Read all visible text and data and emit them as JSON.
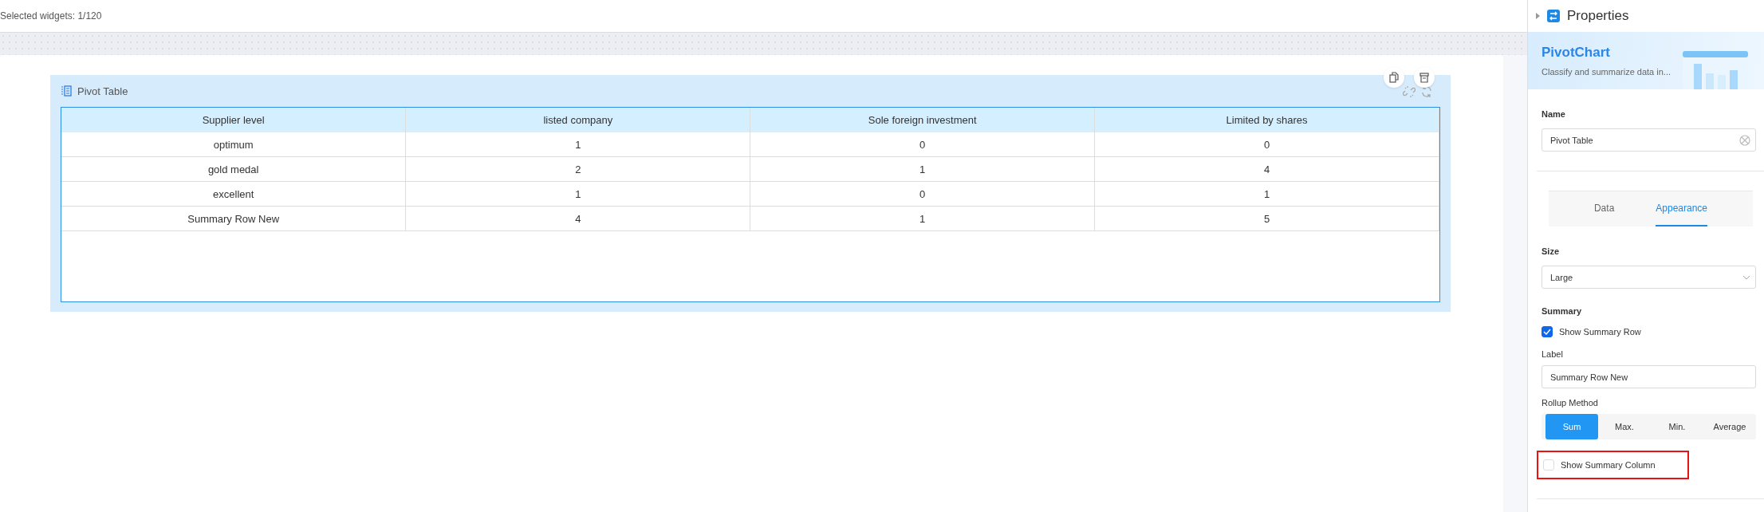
{
  "top_bar": {
    "selection_text": "Selected widgets: 1/120"
  },
  "widget": {
    "title": "Pivot Table",
    "table": {
      "columns": [
        "Supplier level",
        "listed company",
        "Sole foreign investment",
        "Limited by shares"
      ],
      "rows": [
        [
          "optimum",
          "1",
          "0",
          "0"
        ],
        [
          "gold medal",
          "2",
          "1",
          "4"
        ],
        [
          "excellent",
          "1",
          "0",
          "1"
        ],
        [
          "Summary Row New",
          "4",
          "1",
          "5"
        ]
      ]
    }
  },
  "properties": {
    "title": "Properties",
    "banner": {
      "title": "PivotChart",
      "description": "Classify and summarize data in..."
    },
    "name": {
      "label": "Name",
      "value": "Pivot Table"
    },
    "tabs": [
      {
        "label": "Data",
        "selected": false
      },
      {
        "label": "Appearance",
        "selected": true
      }
    ],
    "size": {
      "label": "Size",
      "value": "Large"
    },
    "summary": {
      "heading": "Summary",
      "show_row": {
        "label": "Show Summary Row",
        "checked": true
      },
      "label_field": {
        "label": "Label",
        "value": "Summary Row New"
      },
      "rollup": {
        "label": "Rollup Method",
        "options": [
          {
            "label": "Sum",
            "selected": true
          },
          {
            "label": "Max.",
            "selected": false
          },
          {
            "label": "Min.",
            "selected": false
          },
          {
            "label": "Average",
            "selected": false
          }
        ]
      },
      "show_column": {
        "label": "Show Summary Column",
        "checked": false,
        "highlighted": true
      }
    }
  }
}
